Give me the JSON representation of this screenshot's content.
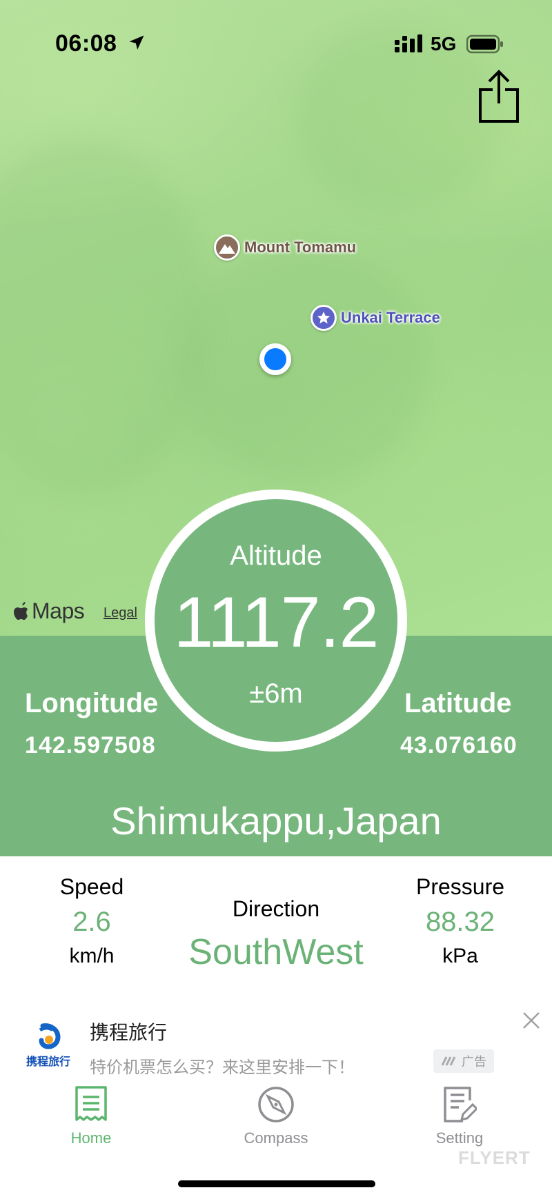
{
  "status_bar": {
    "time": "06:08",
    "network": "5G"
  },
  "map": {
    "pois": [
      {
        "label": "Mount Tomamu",
        "icon": "mountain-icon"
      },
      {
        "label": "Unkai Terrace",
        "icon": "star-icon"
      }
    ],
    "attribution": "Maps",
    "legal": "Legal"
  },
  "altitude": {
    "label": "Altitude",
    "value": "1117.2",
    "accuracy": "±6m"
  },
  "longitude": {
    "label": "Longitude",
    "value": "142.597508"
  },
  "latitude": {
    "label": "Latitude",
    "value": "43.076160"
  },
  "location": "Shimukappu,Japan",
  "stats": {
    "speed": {
      "label": "Speed",
      "value": "2.6",
      "unit": "km/h"
    },
    "direction": {
      "label": "Direction",
      "value": "SouthWest"
    },
    "pressure": {
      "label": "Pressure",
      "value": "88.32",
      "unit": "kPa"
    }
  },
  "ad": {
    "logo_text": "携程旅行",
    "title": "携程旅行",
    "description": "特价机票怎么买？来这里安排一下！",
    "badge": "广告"
  },
  "tabs": [
    {
      "label": "Home",
      "icon": "receipt-icon",
      "active": true
    },
    {
      "label": "Compass",
      "icon": "compass-icon",
      "active": false
    },
    {
      "label": "Setting",
      "icon": "document-edit-icon",
      "active": false
    }
  ],
  "watermark": "FLYERT",
  "colors": {
    "panel_green": "#77b77e",
    "value_green": "#6bb277",
    "active_tab": "#5cb56e",
    "user_dot": "#0a7aff"
  }
}
